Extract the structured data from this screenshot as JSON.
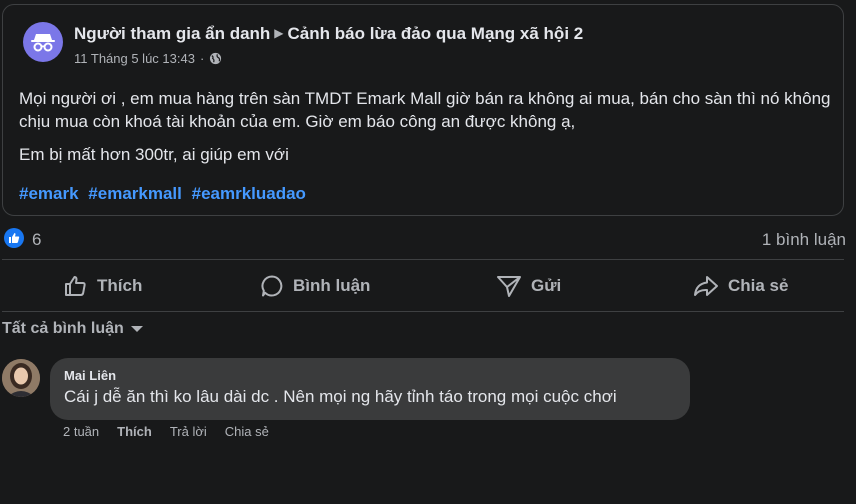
{
  "post": {
    "author": "Người tham gia ẩn danh",
    "group": "Cảnh báo lừa đảo qua Mạng xã hội 2",
    "timestamp": "11 Tháng 5 lúc 13:43",
    "separator": "·",
    "body_line1": "Mọi người ơi , em mua hàng trên sàn TMDT Emark  Mall giờ bán ra không ai mua, bán cho sàn thì nó không chịu mua còn khoá tài khoản của em. Giờ em báo công an được không ạ,",
    "body_line2": "Em bị mất hơn 300tr, ai giúp em với",
    "hashtags": [
      "#emark",
      "#emarkmall",
      "#eamrkluadao"
    ]
  },
  "stats": {
    "reaction_count": "6",
    "comment_count": "1 bình luận"
  },
  "actions": {
    "like": "Thích",
    "comment": "Bình luận",
    "send": "Gửi",
    "share": "Chia sẻ"
  },
  "comments_header": {
    "sort_label": "Tất cả bình luận"
  },
  "comment": {
    "author": "Mai Liên",
    "text": "Cái j dễ ăn thì ko lâu dài dc . Nên mọi ng hãy tỉnh táo trong mọi cuộc chơi",
    "time": "2 tuần",
    "like": "Thích",
    "reply": "Trả lời",
    "share": "Chia sẻ"
  },
  "colors": {
    "background": "#18191a",
    "text_primary": "#e4e6eb",
    "text_secondary": "#b0b3b8",
    "hashtag": "#4599ff",
    "anon_avatar": "#7b77e8",
    "like_blue": "#1877f2",
    "bubble": "#3a3b3c"
  },
  "icons": [
    "incognito-icon",
    "globe-icon",
    "like-reaction-icon",
    "thumbs-up-icon",
    "comment-icon",
    "send-icon",
    "share-icon",
    "caret-down-icon"
  ]
}
